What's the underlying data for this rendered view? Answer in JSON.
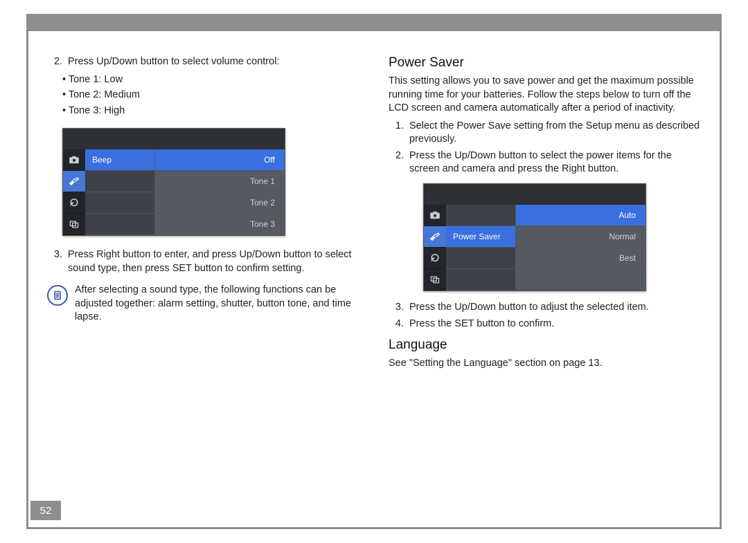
{
  "pageNumber": "52",
  "left": {
    "step2": {
      "num": "2.",
      "text": "Press Up/Down button to select volume control:"
    },
    "bullets": [
      "Tone 1: Low",
      "Tone 2: Medium",
      "Tone 3: High"
    ],
    "screenshot1": {
      "tabs": [
        "camera",
        "brush",
        "refresh",
        "overlap"
      ],
      "selectedTab": 1,
      "left": [
        "Beep",
        "",
        "",
        ""
      ],
      "right": [
        "Off",
        "Tone 1",
        "Tone 2",
        "Tone 3"
      ],
      "selLeft": 0,
      "selRight": 0
    },
    "step3": {
      "num": "3.",
      "pre": "Press Right button to enter, and press Up/Down button to select sound type, then press ",
      "set": "SET",
      "post": " button to confirm setting."
    },
    "note": "After selecting a sound type, the following functions can be adjusted together: alarm setting, shutter, button tone, and time lapse."
  },
  "right": {
    "h1": "Power Saver",
    "intro": "This setting allows you to save power and get the maximum possible running time for your batteries. Follow the steps below to turn off the LCD screen and camera automatically after a period of inactivity.",
    "r1": {
      "num": "1.",
      "text": "Select the Power Save setting from the Setup menu as described previously."
    },
    "r2": {
      "num": "2.",
      "text": "Press the Up/Down button to select the power items for the screen and camera and press the Right button."
    },
    "screenshot2": {
      "tabs": [
        "camera",
        "brush",
        "refresh",
        "overlap"
      ],
      "selectedTab": 1,
      "left": [
        "",
        "Power Saver",
        "",
        ""
      ],
      "right": [
        "Auto",
        "Normal",
        "Best",
        ""
      ],
      "selLeft": 1,
      "selRight": 0
    },
    "r3": {
      "num": "3.",
      "text": "Press the Up/Down button to adjust the selected item."
    },
    "r4": {
      "num": "4.",
      "pre": "Press the ",
      "set": "SET",
      "post": " button to confirm."
    },
    "h2": "Language",
    "langNote": "See \"Setting the Language\" section on page 13."
  }
}
